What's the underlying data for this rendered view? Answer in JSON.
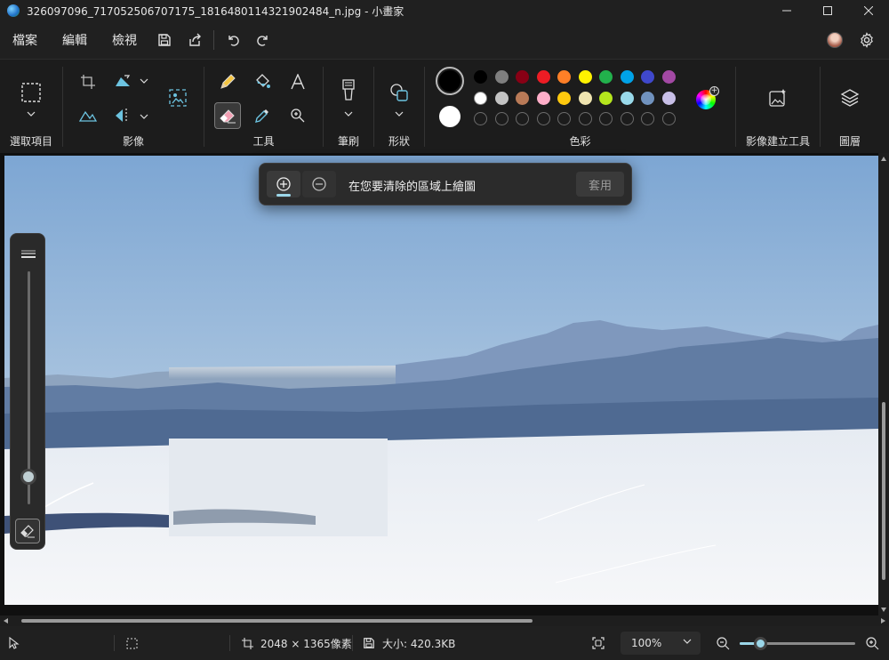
{
  "window": {
    "title": "326097096_717052506707175_1816480114321902484_n.jpg - 小畫家"
  },
  "menu": {
    "items": [
      "檔案",
      "編輯",
      "檢視"
    ]
  },
  "ribbon": {
    "groups": {
      "selection": "選取項目",
      "image": "影像",
      "tools": "工具",
      "brushes": "筆刷",
      "shapes": "形狀",
      "colors": "色彩",
      "image_creator": "影像建立工具",
      "layers": "圖層"
    },
    "colors": {
      "primary": "#000000",
      "secondary": "#ffffff",
      "row1": [
        "#000000",
        "#7f7f7f",
        "#880015",
        "#ed1c24",
        "#ff7f27",
        "#fff200",
        "#22b14c",
        "#00a2e8",
        "#3f48cc",
        "#a349a4"
      ],
      "row2": [
        "#ffffff",
        "#c3c3c3",
        "#b97a57",
        "#ffaec9",
        "#ffc90e",
        "#efe4b0",
        "#b5e61d",
        "#99d9ea",
        "#7092be",
        "#c8bfe7"
      ],
      "row3_count": 10
    }
  },
  "erase_toolbar": {
    "instruction": "在您要清除的區域上繪圖",
    "apply_label": "套用"
  },
  "brush_size": {
    "level": 0.12
  },
  "status": {
    "dimensions": "2048 × 1365像素",
    "file_size": "大小: 420.3KB",
    "zoom": "100%",
    "zoom_level": 0.18
  },
  "accent": "#9bd6e8"
}
